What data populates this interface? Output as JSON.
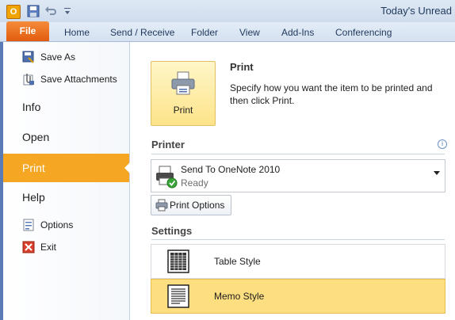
{
  "window": {
    "title": "Today's Unread",
    "app_icon_letter": "O"
  },
  "ribbon": {
    "file_tab": "File",
    "tabs": [
      "Home",
      "Send / Receive",
      "Folder",
      "View",
      "Add-Ins",
      "Conferencing"
    ]
  },
  "nav": {
    "save_as": "Save As",
    "save_attachments": "Save Attachments",
    "info": "Info",
    "open": "Open",
    "print": "Print",
    "help": "Help",
    "options": "Options",
    "exit": "Exit"
  },
  "print_section": {
    "button_label": "Print",
    "heading": "Print",
    "description": "Specify how you want the item to be printed and then click Print."
  },
  "printer": {
    "section_title": "Printer",
    "name": "Send To OneNote 2010",
    "status": "Ready",
    "options_button": "Print Options"
  },
  "settings": {
    "section_title": "Settings",
    "styles": [
      {
        "label": "Table Style",
        "selected": false
      },
      {
        "label": "Memo Style",
        "selected": true
      }
    ]
  },
  "colors": {
    "accent_orange": "#f5a623",
    "file_tab": "#e25b0e",
    "selected_style": "#fdde80"
  }
}
